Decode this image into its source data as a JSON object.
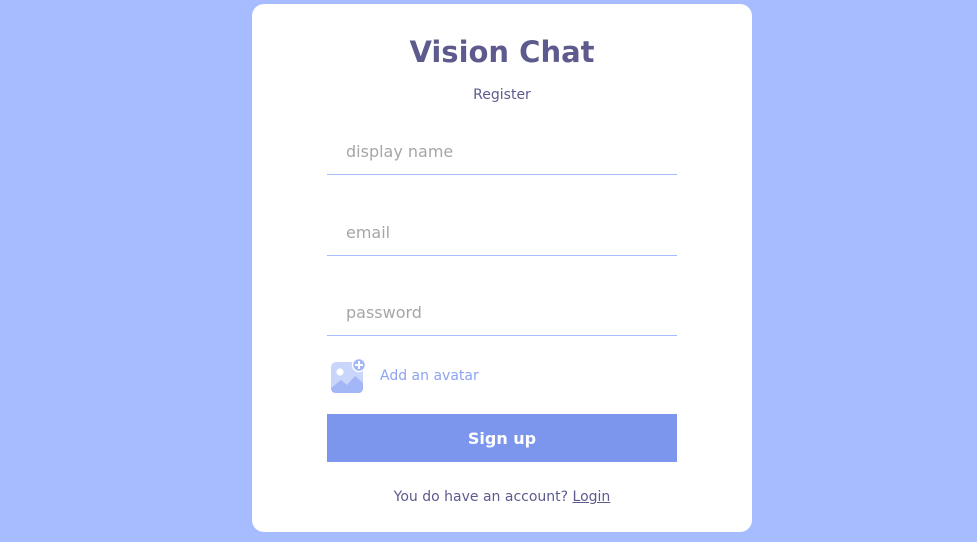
{
  "app": {
    "title": "Vision Chat",
    "subtitle": "Register"
  },
  "form": {
    "display_name_placeholder": "display name",
    "email_placeholder": "email",
    "password_placeholder": "password",
    "avatar": {
      "icon": "add-image-icon",
      "label": "Add an avatar"
    },
    "submit_label": "Sign up"
  },
  "footer": {
    "text": "You do have an account?",
    "link_label": "Login"
  },
  "colors": {
    "background": "#a7bcff",
    "brand": "#5d5b8d",
    "button": "#7b96ec",
    "accent": "#8da4f1"
  }
}
